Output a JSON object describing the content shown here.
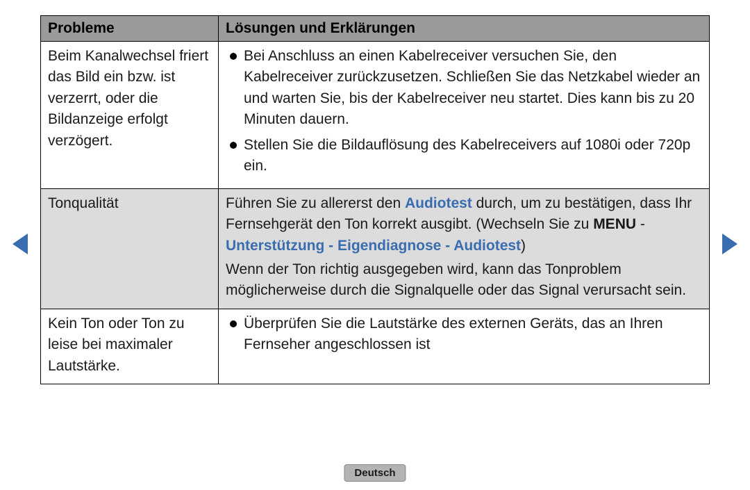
{
  "headers": {
    "col1": "Probleme",
    "col2": "Lösungen und Erklärungen"
  },
  "rows": {
    "r1": {
      "problem": "Beim Kanalwechsel friert das Bild ein bzw. ist verzerrt, oder die Bildanzeige erfolgt verzögert.",
      "b1": "Bei Anschluss an einen Kabelreceiver versuchen Sie, den Kabelreceiver zurückzusetzen. Schließen Sie das Netzkabel wieder an und warten Sie, bis der Kabelreceiver neu startet. Dies kann bis zu 20 Minuten dauern.",
      "b2": "Stellen Sie die Bildauflösung des Kabelreceivers auf 1080i oder 720p ein."
    },
    "r2": {
      "problem": "Tonqualität",
      "p1a": "Führen Sie zu allererst den ",
      "p1_hl": "Audiotest",
      "p1b": " durch, um zu bestätigen, dass Ihr Fernsehgerät den Ton korrekt ausgibt. (Wechseln Sie zu ",
      "p1_menu": "MENU",
      "p1_dash": " - ",
      "p1_path": "Unterstützung - Eigendiagnose - Audiotest",
      "p1_close": ")",
      "p2": "Wenn der Ton richtig ausgegeben wird, kann das Tonproblem möglicherweise durch die Signalquelle oder das Signal verursacht sein."
    },
    "r3": {
      "problem": "Kein Ton oder Ton zu leise bei maximaler Lautstärke.",
      "b1": "Überprüfen Sie die Lautstärke des externen Geräts, das an Ihren Fernseher angeschlossen ist"
    }
  },
  "language": "Deutsch"
}
